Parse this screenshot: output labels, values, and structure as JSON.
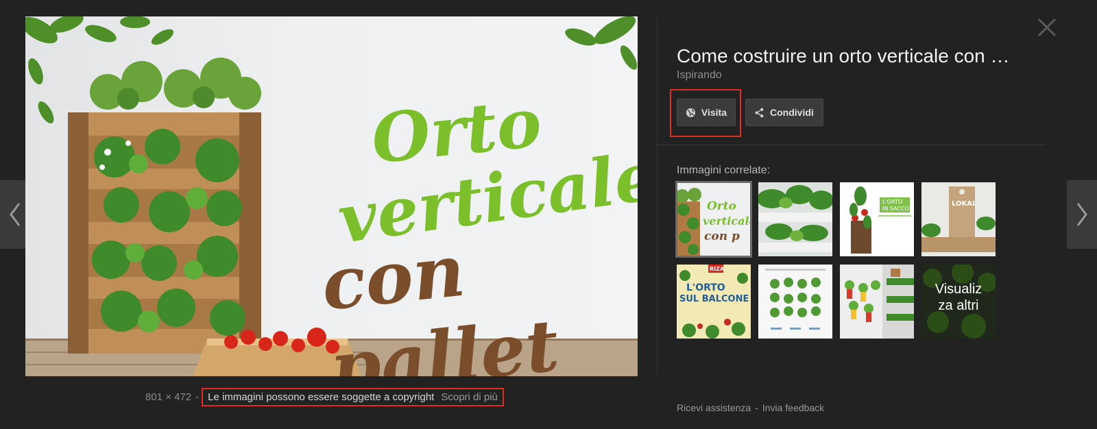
{
  "viewer": {
    "image_alt": "Orto verticale con pallet",
    "image_text": [
      "Orto",
      "verticale",
      "con pallet"
    ],
    "dimensions": "801 × 472",
    "separator": "-",
    "copyright_notice": "Le immagini possono essere soggette a copyright",
    "learn_more": "Scopri di più"
  },
  "panel": {
    "title": "Come costruire un orto verticale con …",
    "source": "Ispirando",
    "visit_label": "Visita",
    "share_label": "Condividi",
    "related_heading": "Immagini correlate:",
    "related": [
      {
        "name": "related-orto-verticale",
        "text": [
          "Orto",
          "verticale",
          "con p"
        ]
      },
      {
        "name": "related-plants-shelf"
      },
      {
        "name": "related-orto-in-sacco",
        "text": [
          "L'ORTO",
          "IN SACCO"
        ]
      },
      {
        "name": "related-lokal",
        "text": [
          "LOKAL"
        ]
      },
      {
        "name": "related-orto-sul-balcone",
        "text": [
          "RIZA",
          "L'ORTO",
          "SUL BALCONE"
        ]
      },
      {
        "name": "related-vertical-planters"
      },
      {
        "name": "related-bottle-garden"
      },
      {
        "name": "related-more",
        "text": [
          "Visualiz",
          "za altri"
        ]
      }
    ]
  },
  "footer": {
    "help": "Ricevi assistenza",
    "separator": "-",
    "feedback": "Invia feedback"
  },
  "colors": {
    "background": "#222222",
    "highlight": "#e12c1f",
    "button": "#3b3b3b",
    "green_text": "#7bbf2a",
    "brown_text": "#7a4e2a"
  }
}
